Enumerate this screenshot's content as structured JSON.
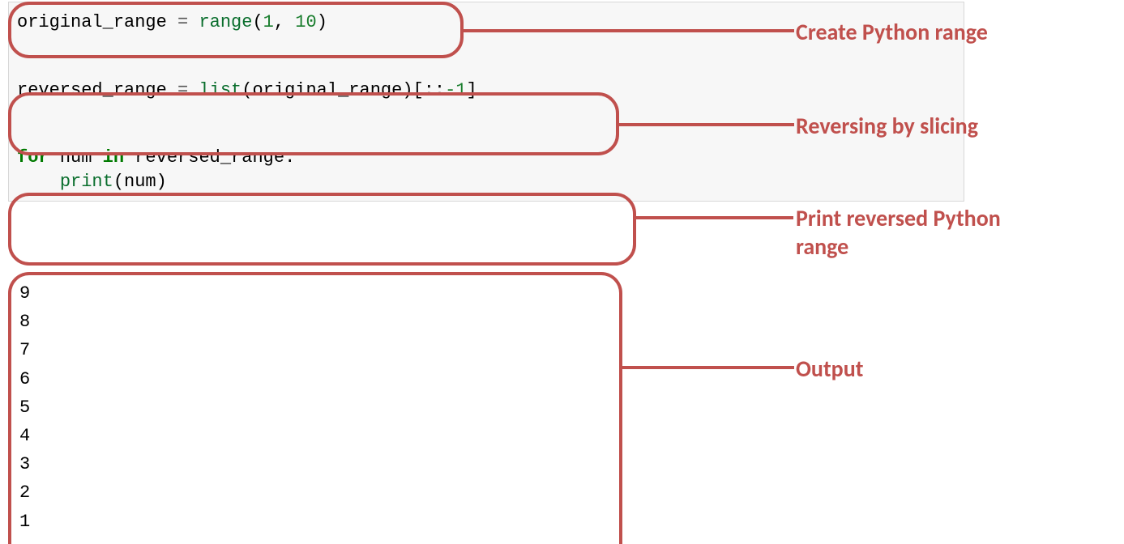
{
  "code": {
    "line1_tokens": {
      "var": "original_range ",
      "eq": "=",
      "sp": " ",
      "range": "range",
      "open": "(",
      "arg1": "1",
      "comma": ", ",
      "arg2": "10",
      "close": ")"
    },
    "line2_tokens": {
      "var": "reversed_range ",
      "eq": "=",
      "sp": " ",
      "list": "list",
      "open": "(",
      "arg": "original_range",
      "close": ")",
      "slice_open": "[::",
      "neg1": "-1",
      "slice_close": "]"
    },
    "line3_tokens": {
      "for": "for",
      "sp1": " ",
      "num": "num ",
      "in": "in",
      "sp2": " ",
      "rr": "reversed_range:"
    },
    "line4_tokens": {
      "indent": "    ",
      "print": "print",
      "open": "(",
      "arg": "num",
      "close": ")"
    }
  },
  "output": "9\n8\n7\n6\n5\n4\n3\n2\n1",
  "annotations": {
    "create": "Create Python range",
    "reverse": "Reversing by slicing",
    "print": "Print reversed Python range",
    "output": "Output"
  }
}
